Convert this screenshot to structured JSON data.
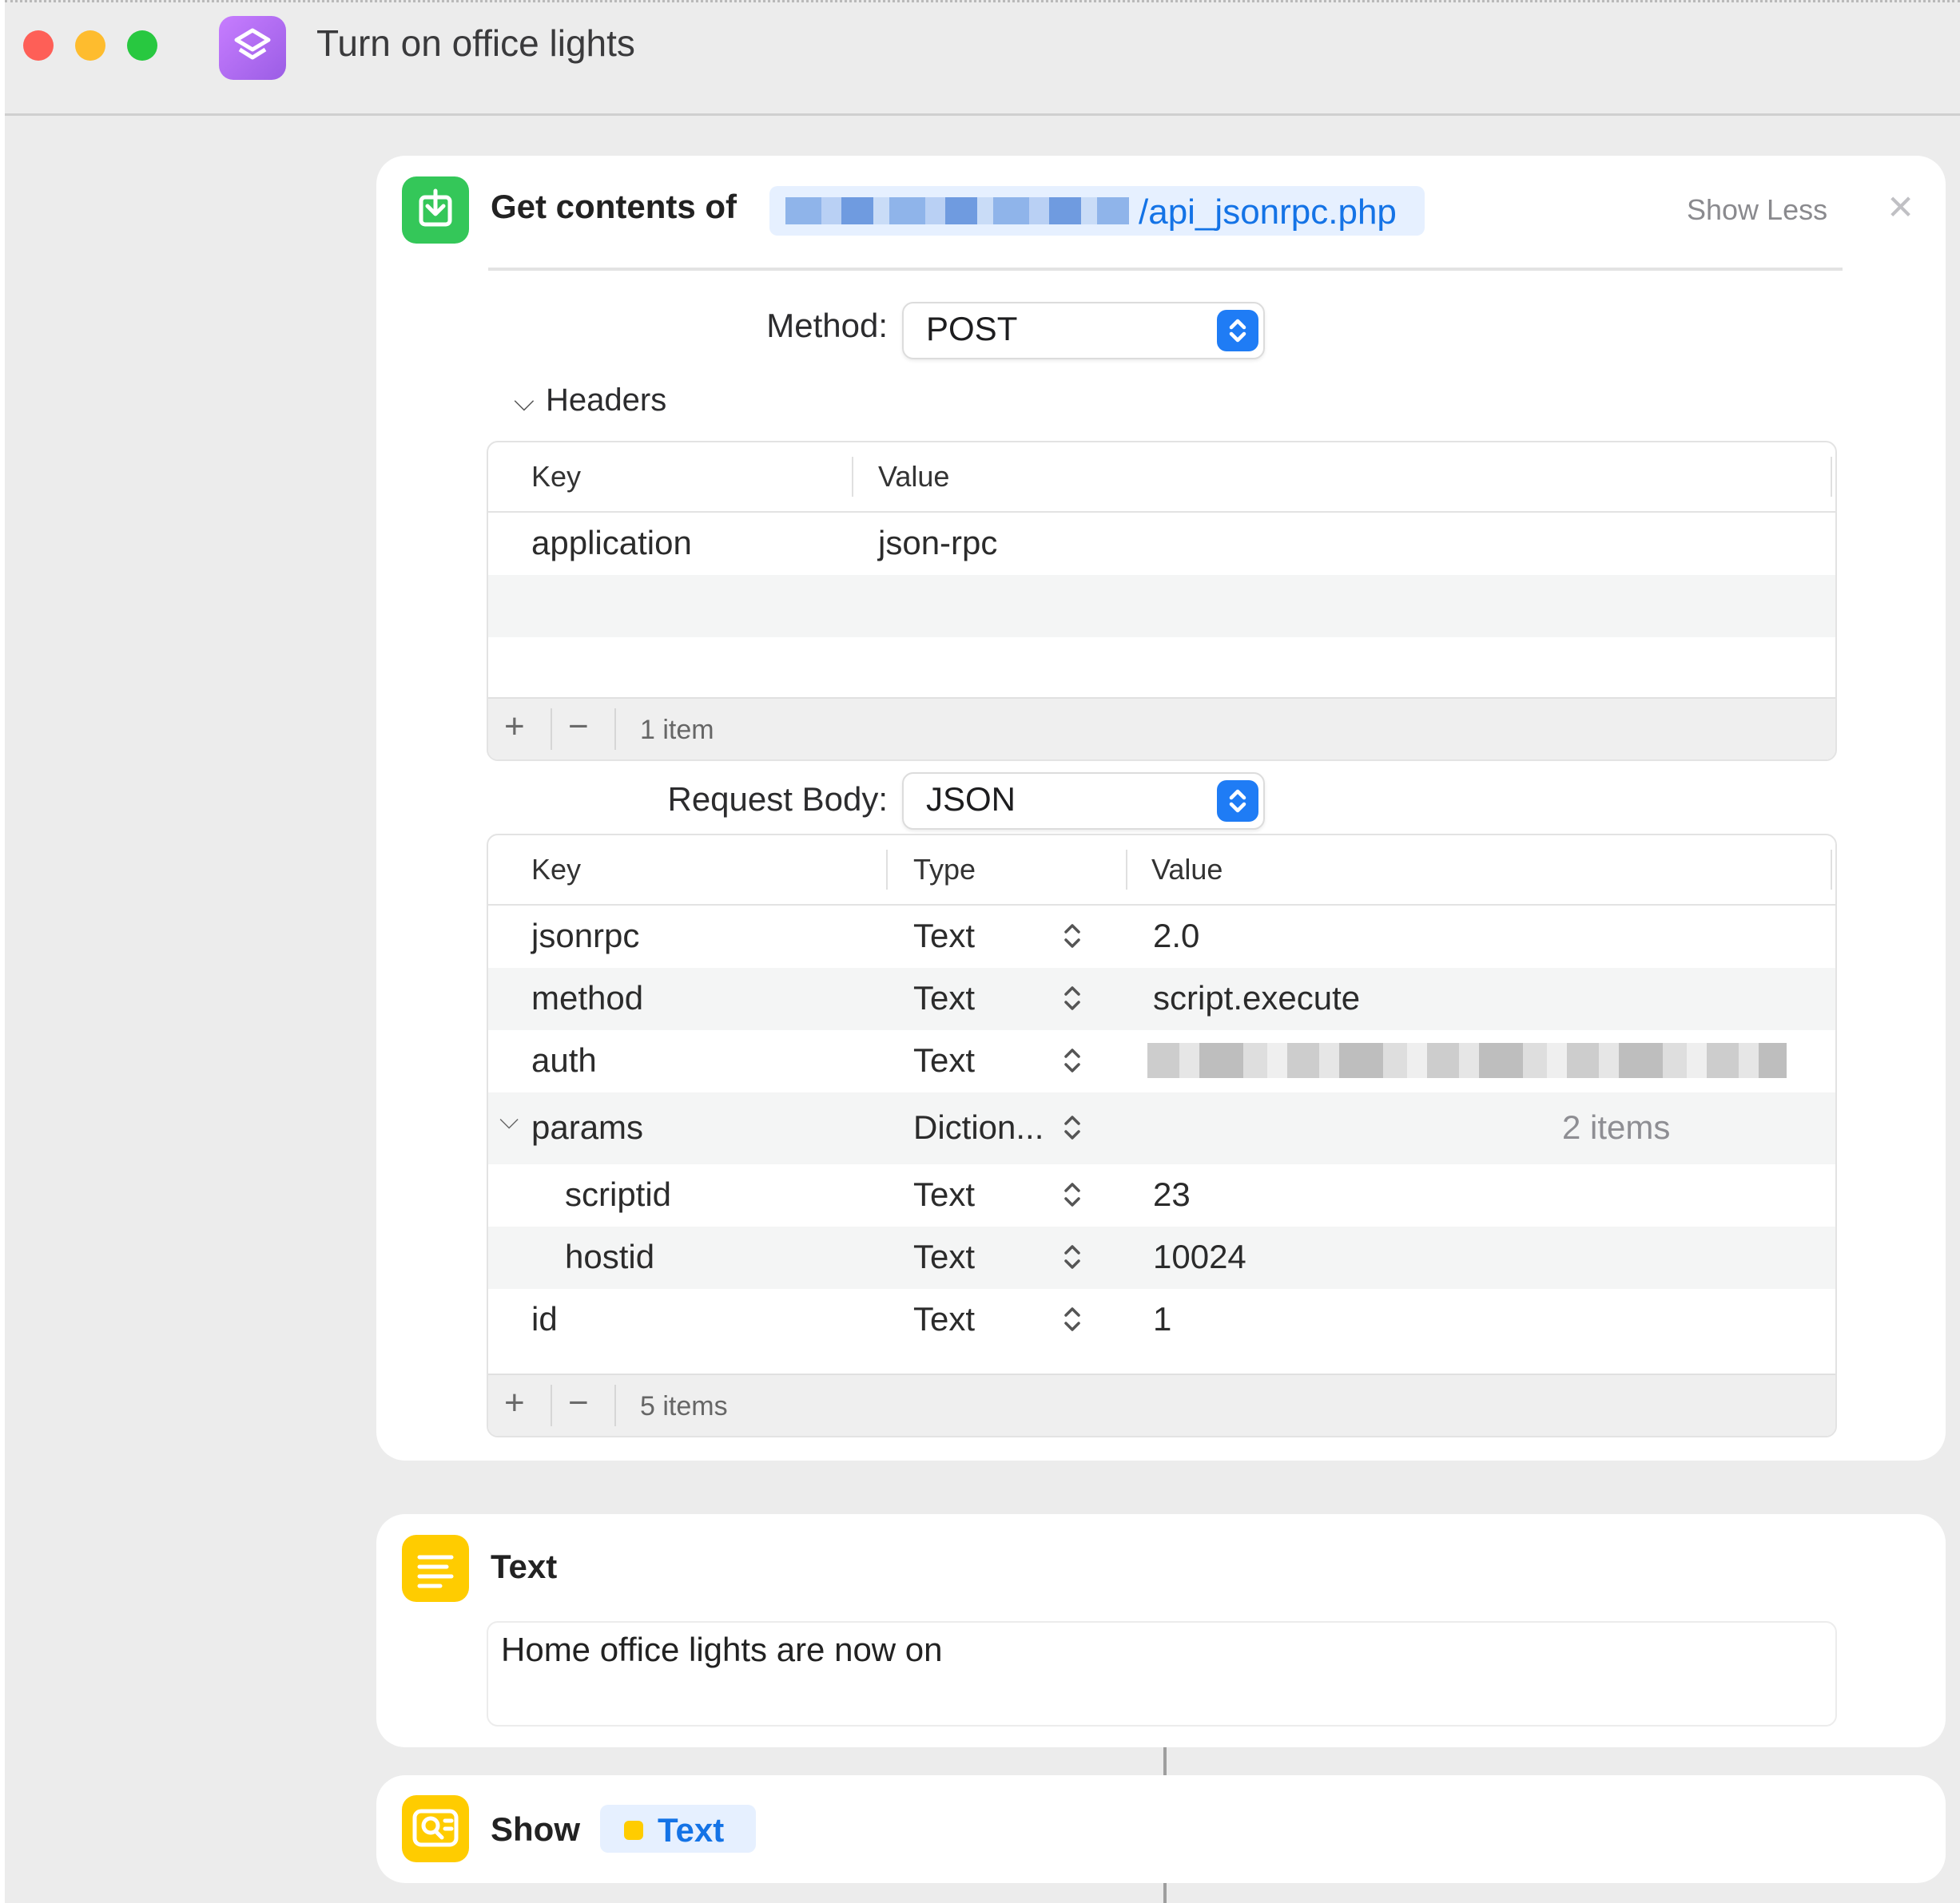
{
  "window": {
    "title": "Turn on office lights",
    "app_icon": "shortcuts-icon"
  },
  "get_contents": {
    "title": "Get contents of",
    "url_suffix": "/api_jsonrpc.php",
    "show_less_label": "Show Less",
    "close_icon": "close-icon",
    "method_label": "Method:",
    "method_value": "POST",
    "headers_label": "Headers",
    "headers_table": {
      "columns": [
        "Key",
        "Value"
      ],
      "rows": [
        {
          "key": "application",
          "value": "json-rpc"
        }
      ],
      "count": "1 item"
    },
    "request_body_label": "Request Body:",
    "request_body_value": "JSON",
    "body_table": {
      "columns": [
        "Key",
        "Type",
        "Value"
      ],
      "rows": [
        {
          "key": "jsonrpc",
          "type": "Text",
          "value": "2.0"
        },
        {
          "key": "method",
          "type": "Text",
          "value": "script.execute"
        },
        {
          "key": "auth",
          "type": "Text",
          "value": ""
        },
        {
          "key": "params",
          "type": "Diction...",
          "value": "2 items"
        },
        {
          "key": "scriptid",
          "type": "Text",
          "value": "23"
        },
        {
          "key": "hostid",
          "type": "Text",
          "value": "10024"
        },
        {
          "key": "id",
          "type": "Text",
          "value": "1"
        }
      ],
      "count": "5 items"
    },
    "footer_add": "+",
    "footer_remove": "−"
  },
  "text_action": {
    "title": "Text",
    "content": "Home office lights are now on"
  },
  "show_action": {
    "title": "Show",
    "variable_label": "Text"
  },
  "colors": {
    "accent": "#1f7cf5",
    "link": "#1473e6",
    "green_action": "#34c759",
    "yellow_action": "#ffcc00",
    "app_purple": "#b06cf0"
  }
}
